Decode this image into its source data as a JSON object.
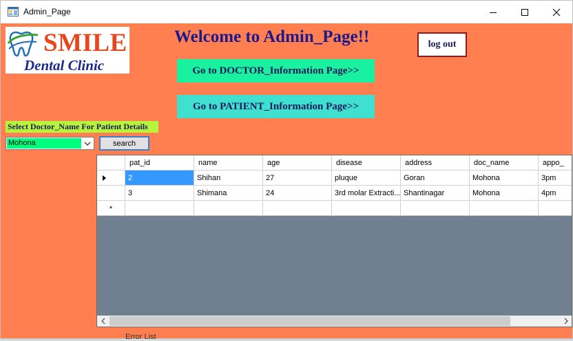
{
  "window": {
    "title": "Admin_Page"
  },
  "logo": {
    "name": "SMILE",
    "subtitle": "Dental Clinic"
  },
  "header": {
    "welcome": "Welcome to Admin_Page!!",
    "logout_label": "log out"
  },
  "nav": {
    "doctor_label": "Go to DOCTOR_Information Page>>",
    "patient_label": "Go to PATIENT_Information Page>>"
  },
  "filter": {
    "label": "Select Doctor_Name For Patient Details",
    "selected_doctor": "Mohona",
    "search_label": "search"
  },
  "grid": {
    "columns": [
      "pat_id",
      "name",
      "age",
      "disease",
      "address",
      "doc_name",
      "appo_"
    ],
    "rows": [
      [
        "2",
        "Shihan",
        "27",
        "pluque",
        "Goran",
        "Mohona",
        "3pm"
      ],
      [
        "3",
        "Shimana",
        "24",
        "3rd molar Extracti...",
        "Shantinagar",
        "Mohona",
        "4pm"
      ]
    ],
    "new_row_marker": "*"
  },
  "background_window": {
    "text": "Error List"
  },
  "colors": {
    "form_background": "#ff7f50",
    "doctor_button": "#19f0a0",
    "patient_button": "#40e0d0",
    "label_background": "#b6f53c",
    "select_highlight": "#00ff7f",
    "grid_background": "#708090",
    "selected_cell": "#3399ff"
  },
  "icons": {
    "app": "form-icon",
    "minimize": "minimize-icon",
    "maximize": "maximize-icon",
    "close": "close-icon",
    "logo": "tooth-icon",
    "dropdown": "chevron-down-icon",
    "row_pointer": "row-pointer-icon",
    "scroll_left": "chevron-left-icon",
    "scroll_right": "chevron-right-icon"
  }
}
